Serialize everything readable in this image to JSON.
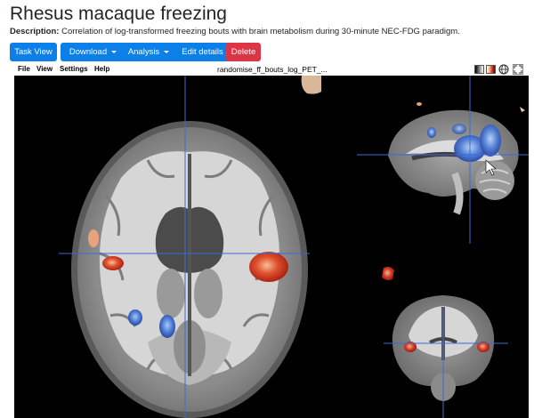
{
  "page": {
    "title": "Rhesus macaque freezing",
    "description_label": "Description:",
    "description_text": " Correlation of log-transformed freezing bouts with brain metabolism during 30-minute NEC-FDG paradigm."
  },
  "toolbar": {
    "task_view": "Task View",
    "download": "Download",
    "analysis": "Analysis",
    "edit_details": "Edit details",
    "delete": "Delete"
  },
  "viewer": {
    "menu": {
      "file": "File",
      "view": "View",
      "settings": "Settings",
      "help": "Help"
    },
    "image_name": "randomise_ff_bouts_log_PET_...",
    "icons": [
      "colormap-gray-icon",
      "colormap-hot-icon",
      "globe-icon",
      "expand-icon"
    ],
    "panels": [
      "axial",
      "sagittal",
      "coronal"
    ]
  },
  "colors": {
    "primary": "#0d7fe8",
    "danger": "#dc3545",
    "crosshair": "#3a6bd6",
    "overlay_hot": "#d8402a",
    "overlay_cool": "#3d6ed0"
  }
}
